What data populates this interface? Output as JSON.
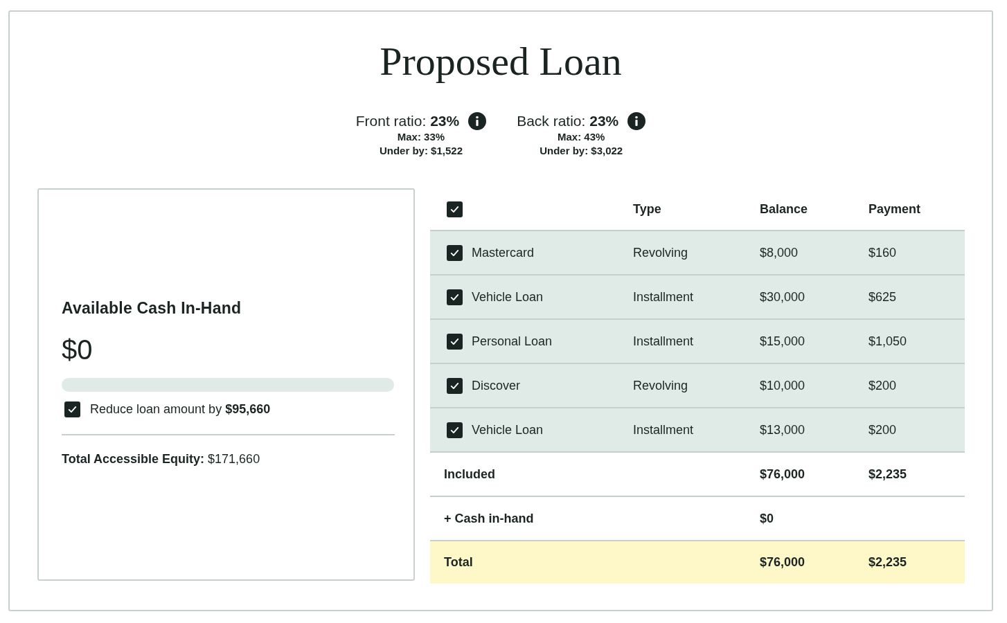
{
  "title": "Proposed Loan",
  "ratios": [
    {
      "label": "Front ratio: **23%**",
      "max": "Max: 33%",
      "under": "Under by: $1,522"
    },
    {
      "label": "Back ratio: **23%**",
      "max": "Max: 43%",
      "under": "Under by: $3,022"
    }
  ],
  "cash_card": {
    "title": "Available Cash In-Hand",
    "amount": "$0",
    "level": 0,
    "reduce": {
      "checked": true,
      "label": "Reduce loan amount by **$95,660**"
    },
    "equity": "**Total Accessible Equity:** $171,660"
  },
  "table": {
    "select_all_checked": true,
    "columns": [
      "Type",
      "Balance",
      "Payment"
    ],
    "rows": [
      {
        "checked": true,
        "name": "Mastercard",
        "type": "Revolving",
        "balance": "$8,000",
        "payment": "$160"
      },
      {
        "checked": true,
        "name": "Vehicle Loan",
        "type": "Installment",
        "balance": "$30,000",
        "payment": "$625"
      },
      {
        "checked": true,
        "name": "Personal Loan",
        "type": "Installment",
        "balance": "$15,000",
        "payment": "$1,050"
      },
      {
        "checked": true,
        "name": "Discover",
        "type": "Revolving",
        "balance": "$10,000",
        "payment": "$200"
      },
      {
        "checked": true,
        "name": "Vehicle Loan",
        "type": "Installment",
        "balance": "$13,000",
        "payment": "$200"
      }
    ],
    "summary": [
      {
        "kind": "included",
        "label": "Included",
        "balance": "$76,000",
        "payment": "$2,235"
      },
      {
        "kind": "cash",
        "label": "+ Cash in-hand",
        "balance": "$0"
      },
      {
        "kind": "total",
        "label": "Total",
        "balance": "$76,000",
        "payment": "$2,235"
      }
    ]
  }
}
